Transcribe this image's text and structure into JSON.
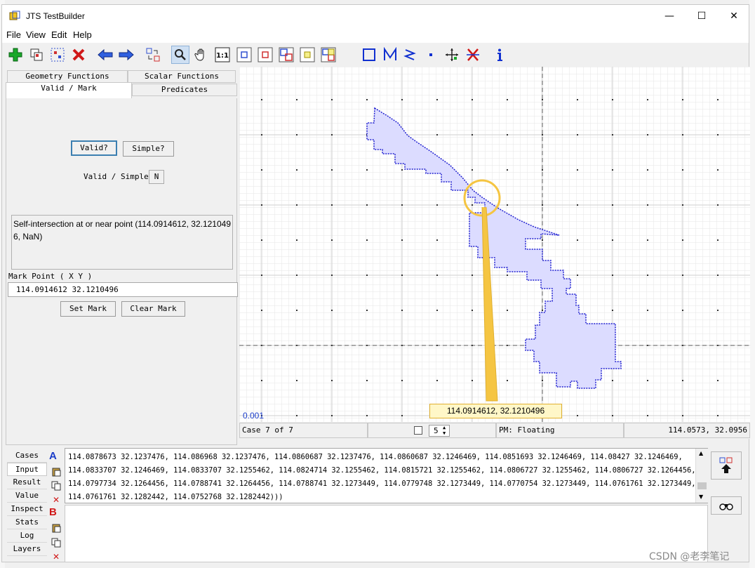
{
  "window": {
    "title": "JTS TestBuilder",
    "minimize": "—",
    "maximize": "☐",
    "close": "✕"
  },
  "menu": [
    "File",
    "View",
    "Edit",
    "Help"
  ],
  "toolbar_icons": [
    "add-case-icon",
    "copy-case-icon",
    "select-icon",
    "delete-icon",
    "prev-case-icon",
    "next-case-icon",
    "exchange-geometries-icon",
    "zoom-icon",
    "pan-icon",
    "one-to-one-icon",
    "zoom-to-a-icon",
    "zoom-to-b-icon",
    "zoom-to-input-icon",
    "zoom-to-result-icon",
    "zoom-to-full-icon",
    "draw-polygon-icon",
    "draw-linestring-icon",
    "draw-line-icon",
    "draw-point-icon",
    "edit-vertex-icon",
    "delete-vertex-icon",
    "info-icon"
  ],
  "left_tabs": {
    "geometry_functions": "Geometry Functions",
    "scalar_functions": "Scalar Functions",
    "valid_mark": "Valid / Mark",
    "predicates": "Predicates"
  },
  "valid_panel": {
    "valid_button": "Valid?",
    "simple_button": "Simple?",
    "valid_simple_label": "Valid / Simple",
    "valid_simple_value": "N",
    "message": "Self-intersection at or near point (114.0914612, 32.1210496, NaN)",
    "mark_point_label": "Mark Point ( X Y )",
    "mark_point_value": "114.0914612   32.1210496",
    "set_mark_button": "Set Mark",
    "clear_mark_button": "Clear Mark"
  },
  "canvas": {
    "grid_size_label": "0.001",
    "mark_tooltip": "114.0914612, 32.1210496",
    "colors": {
      "polygon_fill": "#dcdcff",
      "polygon_stroke": "#2020d0",
      "mark": "#f5c542",
      "tooltip_bg": "#fff7c8"
    }
  },
  "status": {
    "case_label": "Case 7 of 7",
    "spin_value": "5",
    "precision_model": "PM: Floating",
    "cursor_coords": "114.0573,  32.0956"
  },
  "bottom_tabs": [
    "Cases",
    "Input",
    "Result",
    "Value",
    "Inspect",
    "Stats",
    "Log",
    "Layers"
  ],
  "geometry_a_label": "A",
  "geometry_b_label": "B",
  "geometry_a_lines": [
    "114.0878673 32.1237476,  114.086968 32.1237476,  114.0860687 32.1237476,  114.0860687 32.1246469,  114.0851693 32.1246469,  114.08427 32.1246469,",
    "114.0833707 32.1246469,  114.0833707 32.1255462,  114.0824714 32.1255462,  114.0815721 32.1255462,  114.0806727 32.1255462,  114.0806727 32.1264456,",
    "114.0797734 32.1264456,  114.0788741 32.1264456,  114.0788741 32.1273449,  114.0779748 32.1273449,  114.0770754 32.1273449,  114.0761761 32.1273449,",
    "114.0761761 32.1282442,  114.0752768 32.1282442)))"
  ],
  "watermark": "CSDN @老李笔记"
}
